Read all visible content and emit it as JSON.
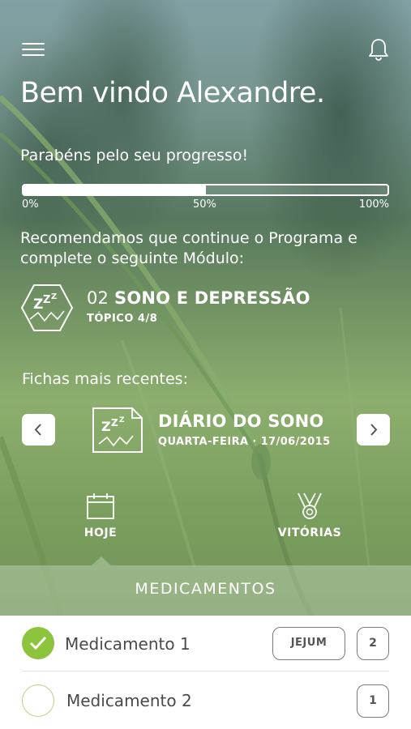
{
  "header": {
    "menu_icon": "hamburger-menu-icon",
    "bell_icon": "bell-icon"
  },
  "welcome": {
    "title": "Bem vindo Alexandre."
  },
  "progress": {
    "label": "Parabéns pelo seu progresso!",
    "value_percent": 50,
    "ticks": [
      "0%",
      "50%",
      "100%"
    ]
  },
  "recommendation": {
    "text": "Recomendamos que continue o Programa e complete o seguinte Módulo:"
  },
  "module": {
    "icon": "sleep-zzz-hexagon-icon",
    "number": "02",
    "title": "SONO E DEPRESSÃO",
    "topic": "TÓPICO 4/8"
  },
  "recent": {
    "label": "Fichas mais recentes:",
    "item": {
      "icon": "sleep-diary-icon",
      "title": "DIÁRIO DO SONO",
      "subtitle": "QUARTA-FEIRA · 17/06/2015"
    }
  },
  "tabs": [
    {
      "label": "HOJE",
      "icon": "calendar-icon",
      "active": true
    },
    {
      "label": "VITÓRIAS",
      "icon": "medal-icon",
      "active": false
    }
  ],
  "medications": {
    "title": "MEDICAMENTOS",
    "items": [
      {
        "name": "Medicamento 1",
        "taken": true,
        "fast_label": "JEJUM",
        "count": "2"
      },
      {
        "name": "Medicamento 2",
        "taken": false,
        "count": "1"
      }
    ]
  },
  "colors": {
    "accent_green": "#8cc43c",
    "panel_white": "#ffffff"
  }
}
